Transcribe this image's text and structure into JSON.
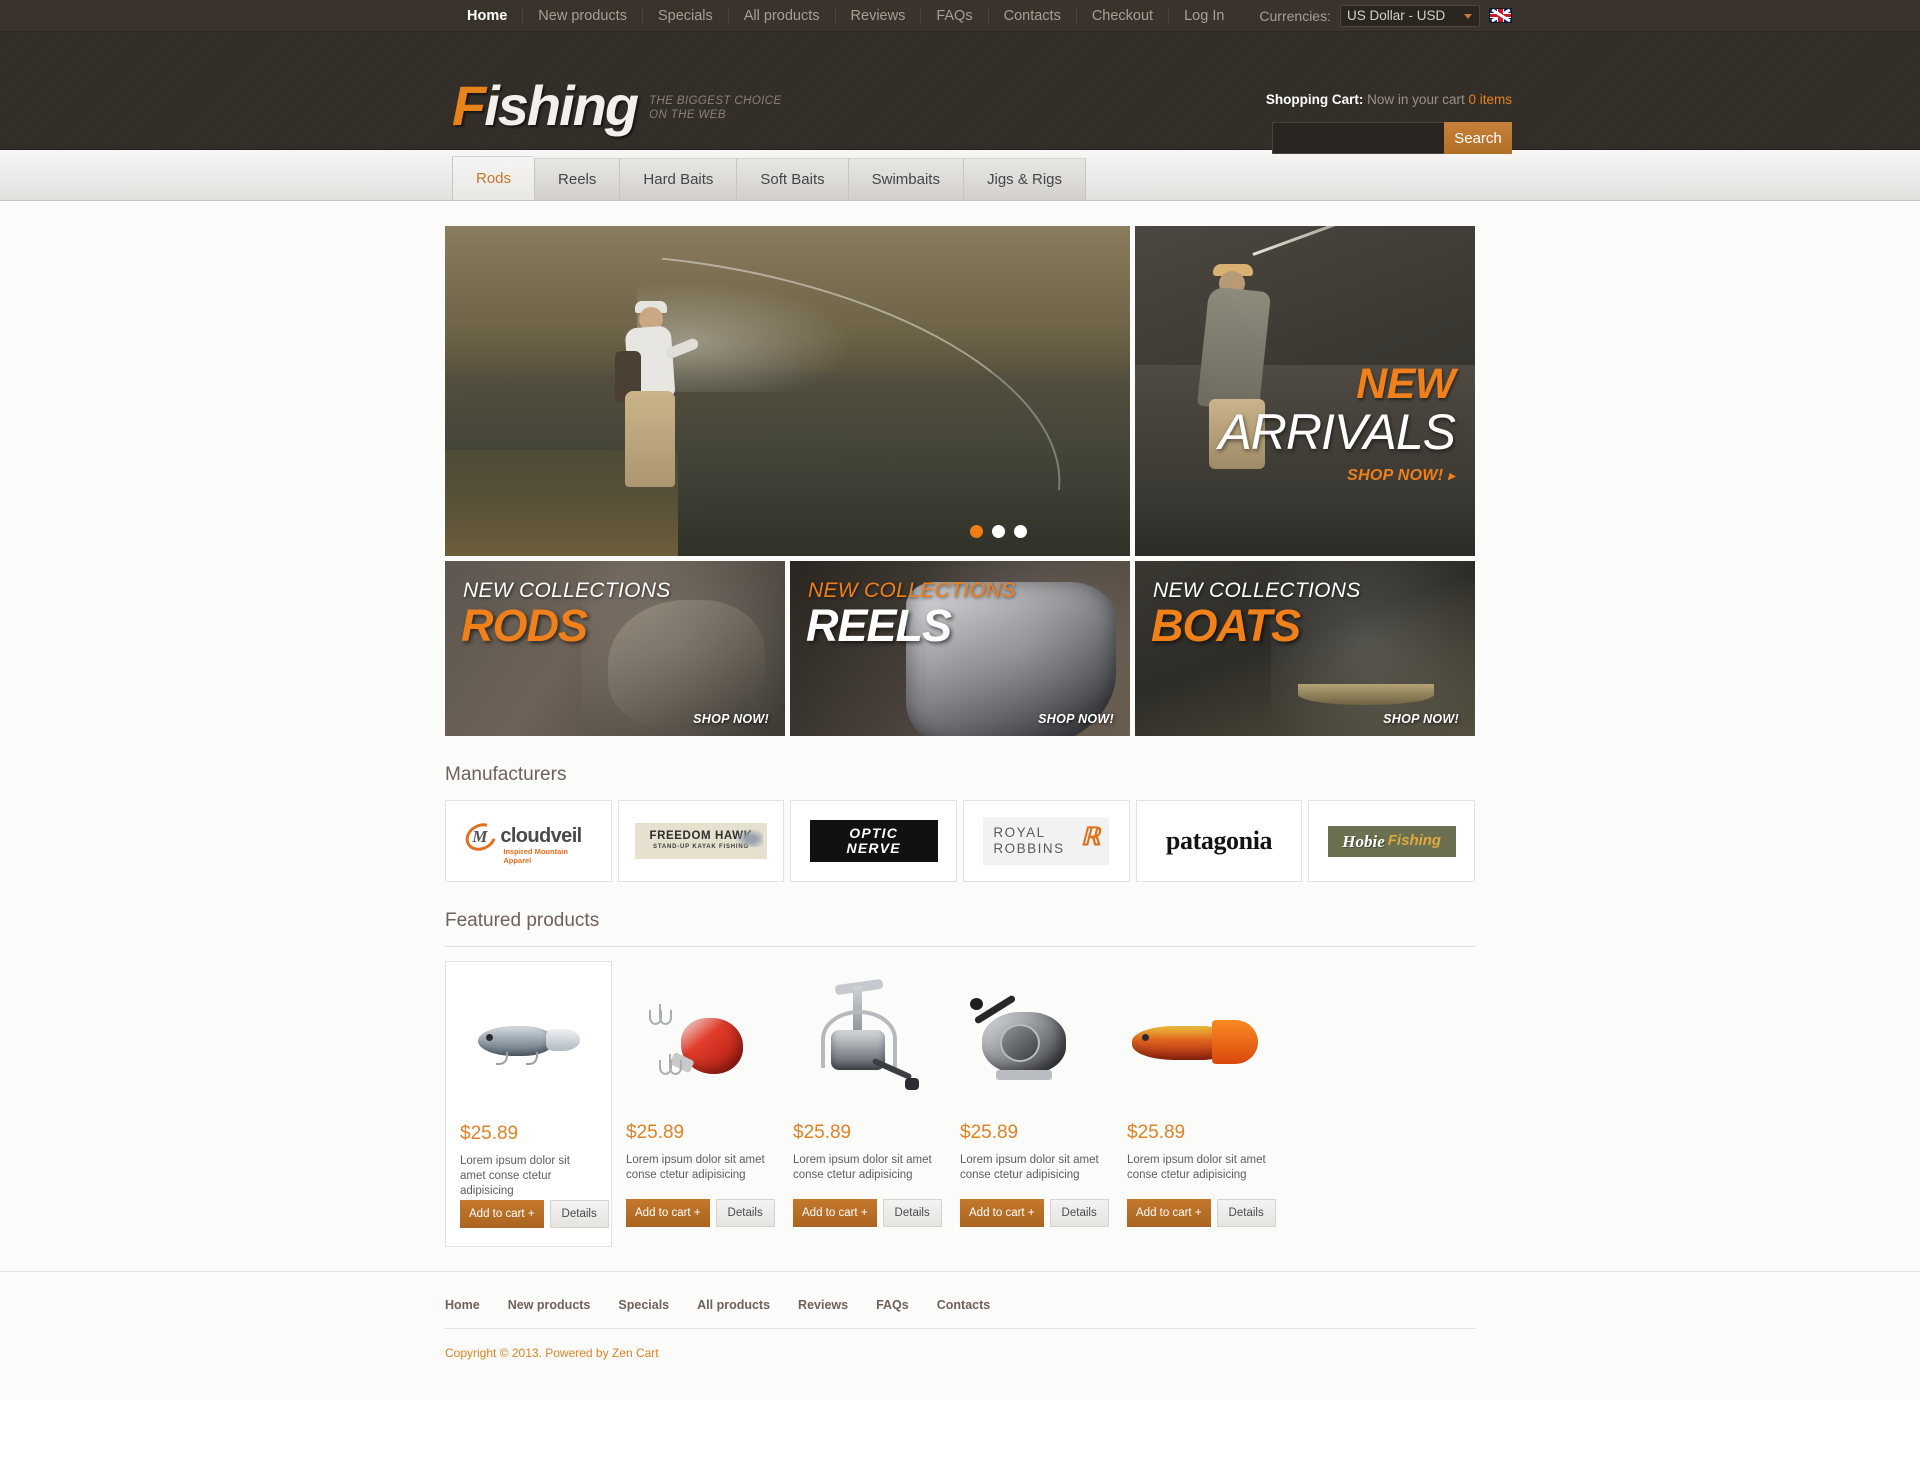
{
  "topbar": {
    "nav": [
      {
        "label": "Home",
        "active": true
      },
      {
        "label": "New products",
        "active": false
      },
      {
        "label": "Specials",
        "active": false
      },
      {
        "label": "All products",
        "active": false
      },
      {
        "label": "Reviews",
        "active": false
      },
      {
        "label": "FAQs",
        "active": false
      },
      {
        "label": "Contacts",
        "active": false
      },
      {
        "label": "Checkout",
        "active": false
      },
      {
        "label": "Log In",
        "active": false
      }
    ],
    "currency_label": "Currencies:",
    "currency_value": "US Dollar  - USD",
    "flag": "uk-flag-icon"
  },
  "header": {
    "logo_first_letter": "F",
    "logo_rest": "ishing",
    "tagline_line1": "THE BIGGEST CHOICE",
    "tagline_line2": "ON THE WEB",
    "cart_title": "Shopping Cart:",
    "cart_text": "Now in your cart",
    "cart_items": "0 items",
    "search_value": "",
    "search_placeholder": "",
    "search_button": "Search"
  },
  "nav": {
    "tabs": [
      {
        "label": "Rods",
        "active": true
      },
      {
        "label": "Reels",
        "active": false
      },
      {
        "label": "Hard Baits",
        "active": false
      },
      {
        "label": "Soft Baits",
        "active": false
      },
      {
        "label": "Swimbaits",
        "active": false
      },
      {
        "label": "Jigs & Rigs",
        "active": false
      }
    ]
  },
  "hero": {
    "slider_dots": 3,
    "active_dot": 0,
    "side": {
      "line1": "NEW",
      "line2": "ARRIVALS",
      "cta": "SHOP NOW!",
      "cta_arrow": "▸"
    }
  },
  "collections": [
    {
      "label": "NEW COLLECTIONS",
      "title": "RODS",
      "cta": "SHOP NOW!",
      "label_color": "#ffffff",
      "title_color": "#f08019"
    },
    {
      "label": "NEW COLLECTIONS",
      "title": "REELS",
      "cta": "SHOP NOW!",
      "label_color": "#f08019",
      "title_color": "#ffffff"
    },
    {
      "label": "NEW COLLECTIONS",
      "title": "BOATS",
      "cta": "SHOP NOW!",
      "label_color": "#ffffff",
      "title_color": "#f08019"
    }
  ],
  "manufacturers": {
    "title": "Manufacturers",
    "items": [
      {
        "name": "cloudveil",
        "word": "cloudveil",
        "mark": "M",
        "sub": "Inspired Mountain Apparel"
      },
      {
        "name": "freedom-hawk",
        "line1": "FREEDOM HAWK",
        "line2": "STAND-UP KAYAK FISHING"
      },
      {
        "name": "optic-nerve",
        "line1": "OPTIC",
        "line2": "NERVE"
      },
      {
        "name": "royal-robbins",
        "line1": "ROYAL",
        "line2": "ROBBINS",
        "mark": "ℝ"
      },
      {
        "name": "patagonia",
        "word": "patagonia"
      },
      {
        "name": "hobie-fishing",
        "word1": "Hobie",
        "word2": "Fishing"
      }
    ]
  },
  "featured": {
    "title": "Featured products",
    "products": [
      {
        "icon": "lure-crankbait-silver",
        "price": "$25.89",
        "desc": "Lorem ipsum dolor sit amet conse ctetur adipisicing",
        "add_label": "Add to cart",
        "add_plus": "+",
        "details_label": "Details"
      },
      {
        "icon": "lure-red-crankbait",
        "price": "$25.89",
        "desc": "Lorem ipsum dolor sit amet conse ctetur adipisicing",
        "add_label": "Add to cart",
        "add_plus": "+",
        "details_label": "Details"
      },
      {
        "icon": "spinning-reel",
        "price": "$25.89",
        "desc": "Lorem ipsum dolor sit amet conse ctetur adipisicing",
        "add_label": "Add to cart",
        "add_plus": "+",
        "details_label": "Details"
      },
      {
        "icon": "baitcasting-reel",
        "price": "$25.89",
        "desc": "Lorem ipsum dolor sit amet conse ctetur adipisicing",
        "add_label": "Add to cart",
        "add_plus": "+",
        "details_label": "Details"
      },
      {
        "icon": "soft-swimbait",
        "price": "$25.89",
        "desc": "Lorem ipsum dolor sit amet conse ctetur adipisicing",
        "add_label": "Add to cart",
        "add_plus": "+",
        "details_label": "Details"
      }
    ]
  },
  "footer": {
    "nav": [
      "Home",
      "New products",
      "Specials",
      "All products",
      "Reviews",
      "FAQs",
      "Contacts"
    ],
    "copyright": "Copyright © 2013. Powered by Zen Cart"
  },
  "colors": {
    "accent_orange": "#e08226",
    "hero_orange": "#f08019",
    "dark_header": "#332d27",
    "topbar": "#3a332c"
  }
}
